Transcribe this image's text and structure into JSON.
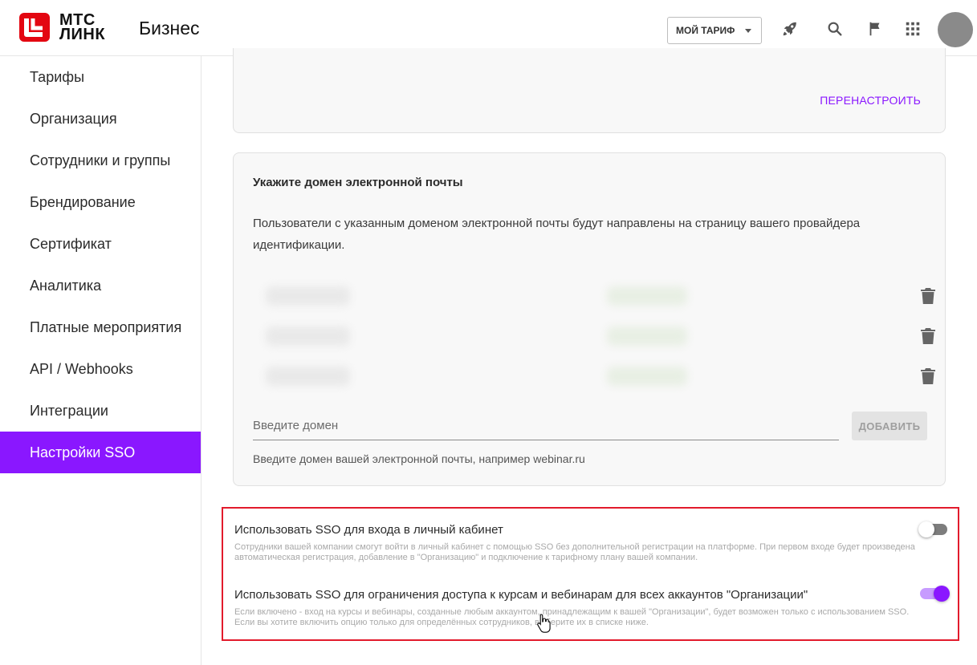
{
  "header": {
    "logo_line1": "МТС",
    "logo_line2": "ЛИНК",
    "product": "Бизнес",
    "tariff_button": "МОЙ ТАРИФ",
    "icons": [
      "rocket-icon",
      "search-icon",
      "flag-icon",
      "apps-grid-icon",
      "avatar"
    ]
  },
  "sidebar": {
    "items": [
      {
        "label": "Тарифы"
      },
      {
        "label": "Организация"
      },
      {
        "label": "Сотрудники и группы"
      },
      {
        "label": "Брендирование"
      },
      {
        "label": "Сертификат"
      },
      {
        "label": "Аналитика"
      },
      {
        "label": "Платные мероприятия"
      },
      {
        "label": "API / Webhooks"
      },
      {
        "label": "Интеграции"
      },
      {
        "label": "Настройки SSO"
      }
    ],
    "active_index": 9
  },
  "reconfigure": {
    "button": "ПЕРЕНАСТРОИТЬ"
  },
  "domain_card": {
    "title": "Укажите домен электронной почты",
    "description": "Пользователи с указанным доменом электронной почты будут направлены на страницу вашего провайдера идентификации.",
    "input_placeholder": "Введите домен",
    "add_button": "ДОБАВИТЬ",
    "hint": "Введите домен вашей электронной почты, например webinar.ru"
  },
  "options": [
    {
      "title": "Использовать SSO для входа в личный кабинет",
      "description": "Сотрудники вашей компании смогут войти в личный кабинет с помощью SSO без дополнительной регистрации на платформе. При первом входе будет произведена автоматическая регистрация, добавление в \"Организацию\" и подключение к тарифному плану вашей компании.",
      "enabled": false
    },
    {
      "title": "Использовать SSO для ограничения доступа к курсам и вебинарам для всех аккаунтов \"Организации\"",
      "description": "Если включено - вход на курсы и вебинары, созданные любым аккаунтом, принадлежащим к вашей \"Организации\", будет возможен только с использованием SSO. Если вы хотите включить опцию только для определённых сотрудников, выберите их в списке ниже.",
      "enabled": true
    }
  ],
  "colors": {
    "accent": "#8a17ff",
    "logo_red": "#e30611",
    "highlight_border": "#e21b2c"
  }
}
